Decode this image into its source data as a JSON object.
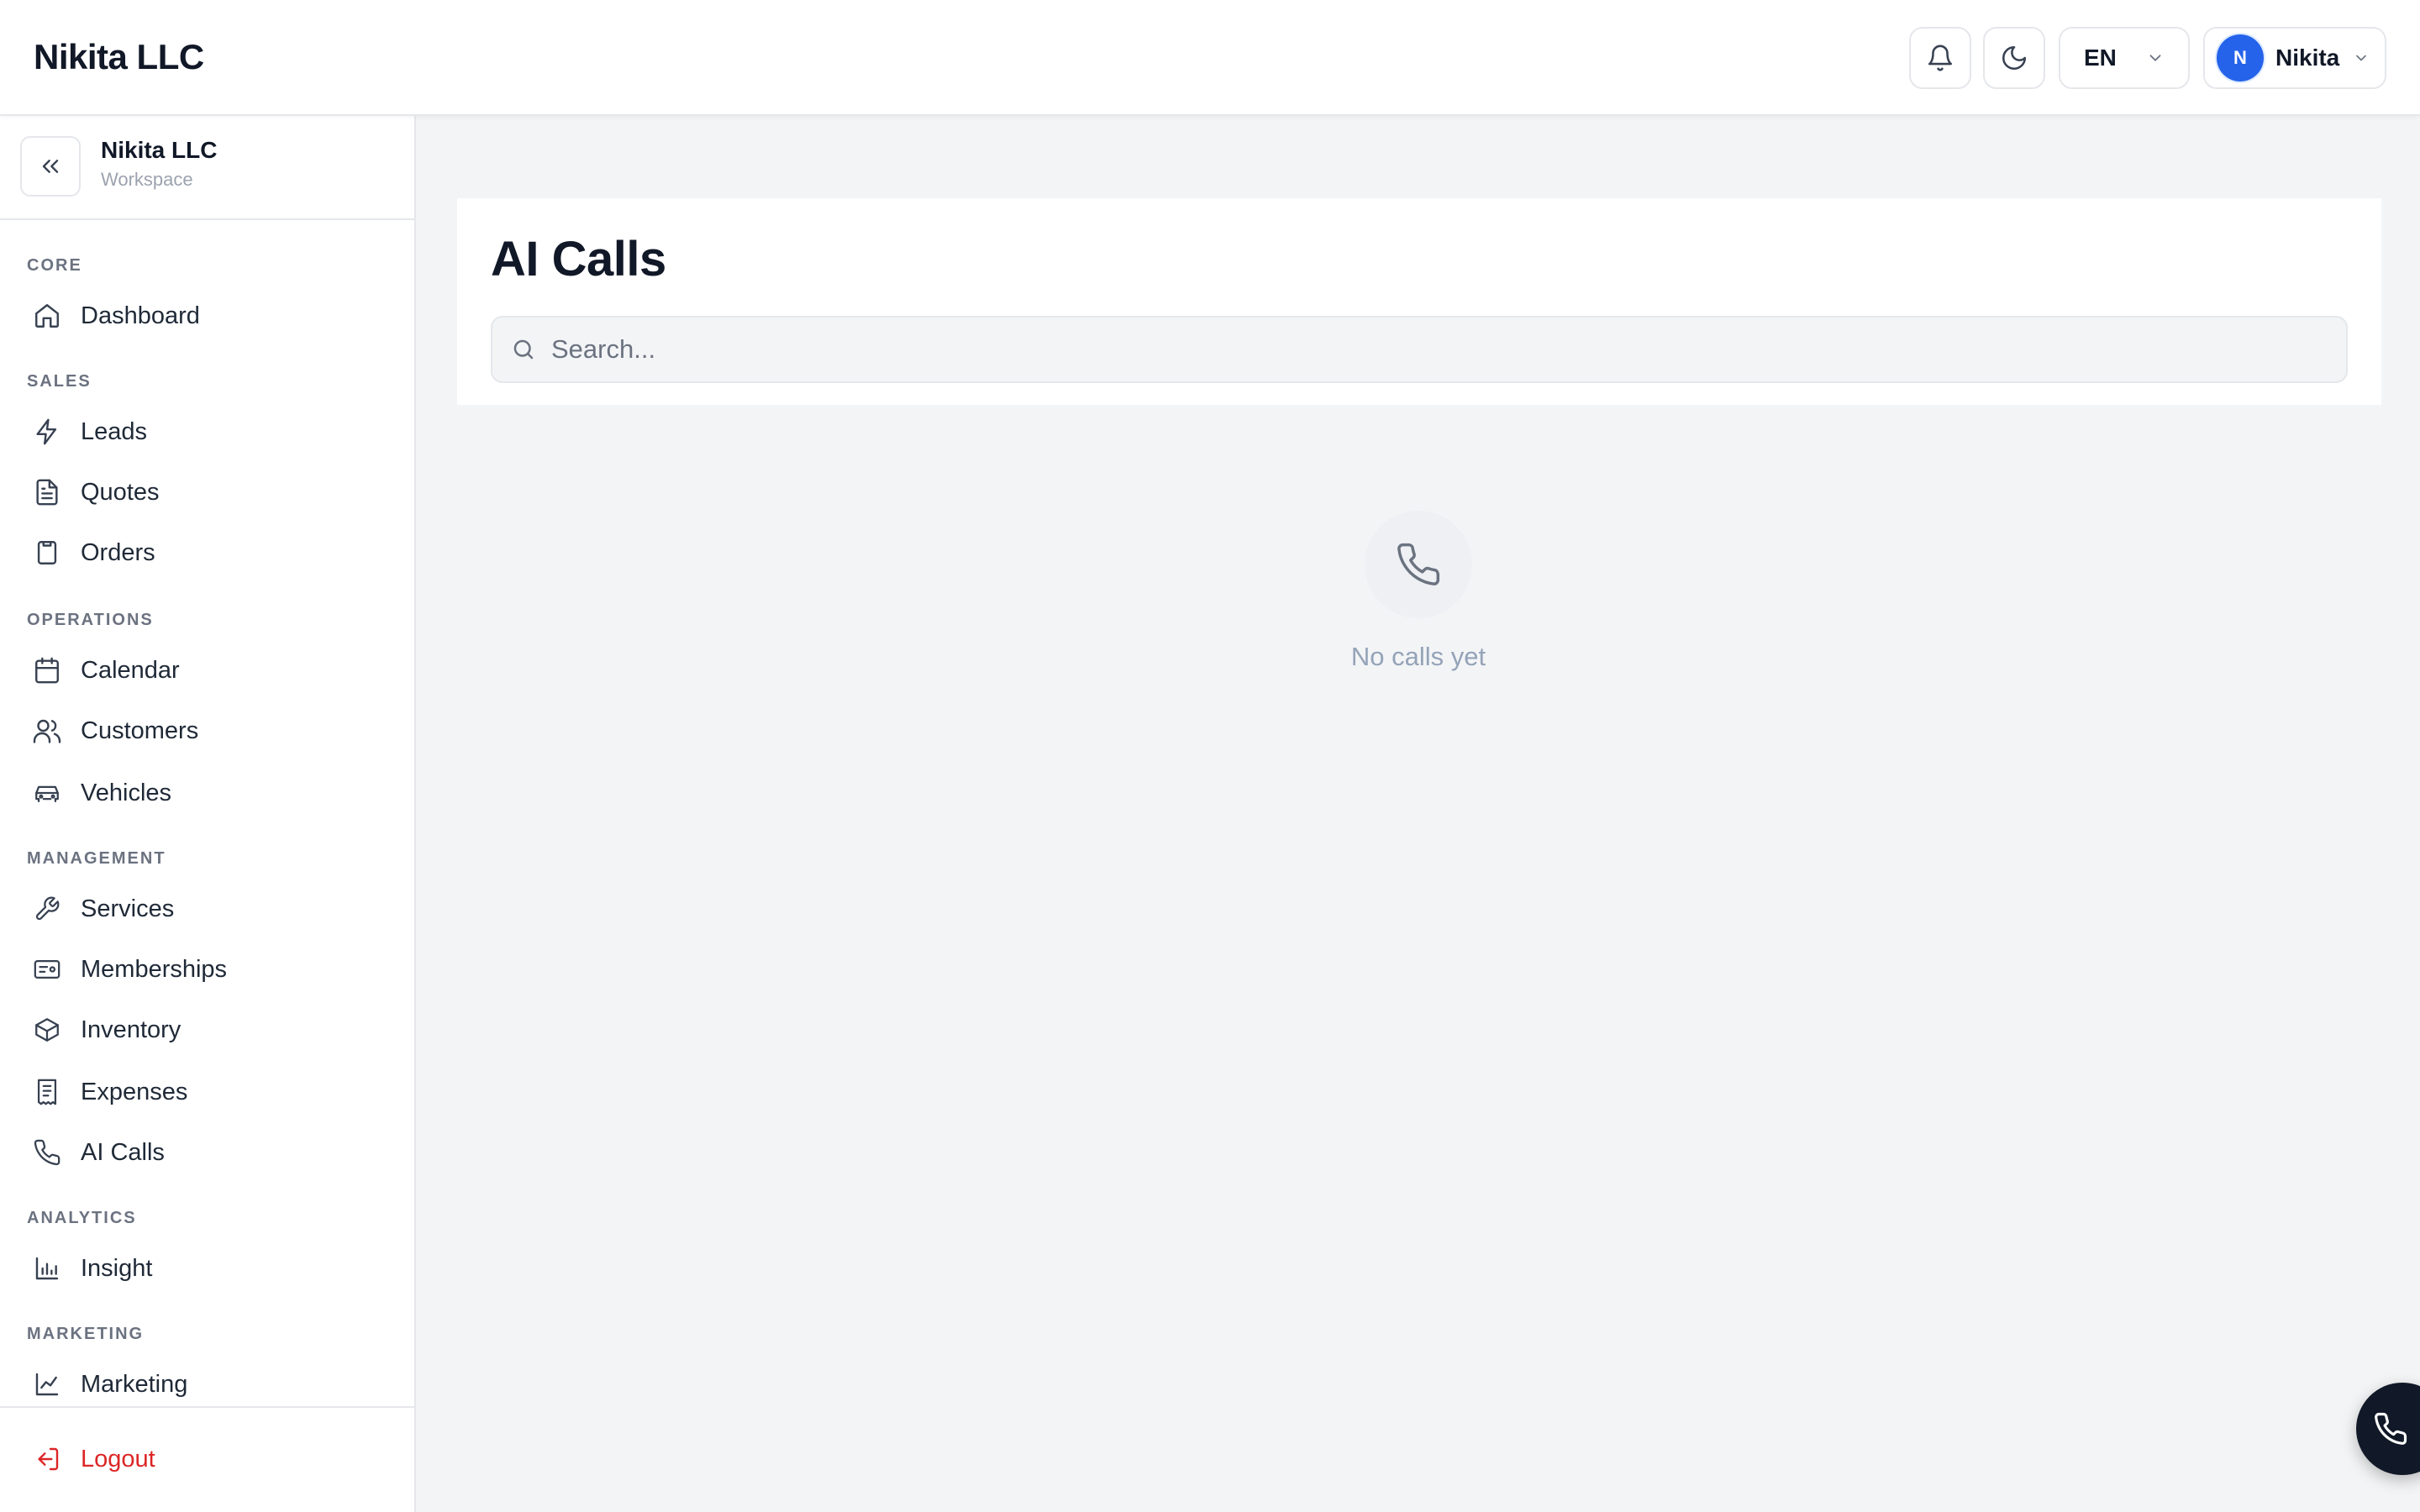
{
  "header": {
    "brand": "Nikita LLC",
    "language": "EN",
    "user_initial": "N",
    "user_name": "Nikita"
  },
  "workspace": {
    "name": "Nikita LLC",
    "subtitle": "Workspace"
  },
  "sidebar": {
    "sections": [
      {
        "label": "CORE",
        "items": [
          {
            "label": "Dashboard",
            "icon": "home-icon"
          }
        ]
      },
      {
        "label": "SALES",
        "items": [
          {
            "label": "Leads",
            "icon": "lightning-icon"
          },
          {
            "label": "Quotes",
            "icon": "document-icon"
          },
          {
            "label": "Orders",
            "icon": "clipboard-icon"
          }
        ]
      },
      {
        "label": "OPERATIONS",
        "items": [
          {
            "label": "Calendar",
            "icon": "calendar-icon"
          },
          {
            "label": "Customers",
            "icon": "users-icon"
          },
          {
            "label": "Vehicles",
            "icon": "car-icon"
          }
        ]
      },
      {
        "label": "MANAGEMENT",
        "items": [
          {
            "label": "Services",
            "icon": "wrench-icon"
          },
          {
            "label": "Memberships",
            "icon": "id-card-icon"
          },
          {
            "label": "Inventory",
            "icon": "box-icon"
          },
          {
            "label": "Expenses",
            "icon": "receipt-icon"
          },
          {
            "label": "AI Calls",
            "icon": "phone-icon"
          }
        ]
      },
      {
        "label": "ANALYTICS",
        "items": [
          {
            "label": "Insight",
            "icon": "bar-chart-icon"
          }
        ]
      },
      {
        "label": "MARKETING",
        "items": [
          {
            "label": "Marketing",
            "icon": "line-chart-icon"
          }
        ]
      }
    ],
    "logout": "Logout"
  },
  "main": {
    "title": "AI Calls",
    "search_placeholder": "Search...",
    "empty_text": "No calls yet"
  },
  "colors": {
    "accent": "#2563eb",
    "logout": "#dc2626",
    "fab": "#111827"
  }
}
